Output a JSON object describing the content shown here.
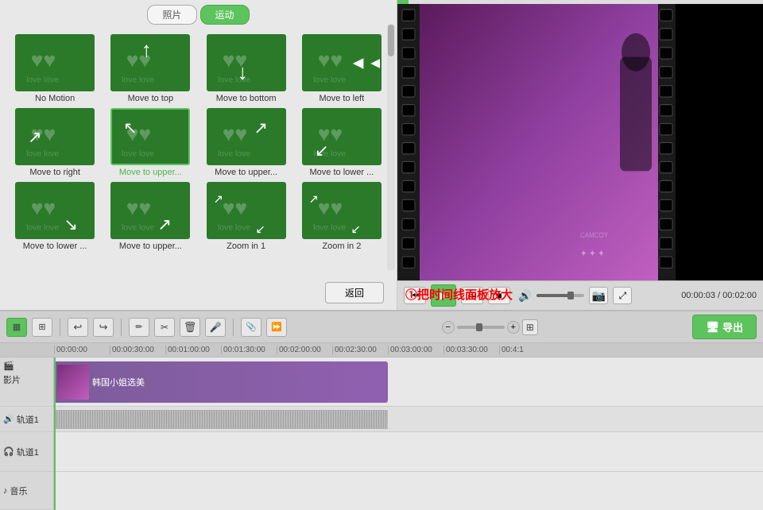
{
  "tabs": {
    "photos_label": "照片",
    "motion_label": "运动"
  },
  "motion_items": [
    {
      "id": "no-motion",
      "label": "No Motion",
      "arrow": "",
      "selected": false
    },
    {
      "id": "move-top",
      "label": "Move to top",
      "arrow": "↑",
      "selected": false
    },
    {
      "id": "move-bottom",
      "label": "Move to bottom",
      "arrow": "↓",
      "selected": false
    },
    {
      "id": "move-left",
      "label": "Move to left",
      "arrow": "◄",
      "selected": false
    },
    {
      "id": "move-right",
      "label": "Move to right",
      "arrow": "↗",
      "selected": false
    },
    {
      "id": "move-upper-left",
      "label": "Move to upper...",
      "arrow": "↖",
      "selected": true
    },
    {
      "id": "move-upper-right",
      "label": "Move to upper...",
      "arrow": "↗",
      "selected": false
    },
    {
      "id": "move-lower-left",
      "label": "Move to lower ...",
      "arrow": "↙",
      "selected": false
    },
    {
      "id": "move-lower-right",
      "label": "Move to lower ...",
      "arrow": "↘",
      "selected": false
    },
    {
      "id": "move-upper-2",
      "label": "Move to upper...",
      "arrow": "↗",
      "selected": false
    },
    {
      "id": "zoom-in-1",
      "label": "Zoom in 1",
      "arrow": "⤢",
      "selected": false
    },
    {
      "id": "zoom-in-2",
      "label": "Zoom in 2",
      "arrow": "⤢",
      "selected": false
    }
  ],
  "back_btn_label": "返回",
  "time_display": "00:00:03 / 00:02:00",
  "annotation_text": "①把时间线面板放大",
  "toolbar": {
    "export_label": "导出",
    "export_icon": "🖥"
  },
  "ruler_marks": [
    "00:00:00",
    "00:00:30:00",
    "00:01:00:00",
    "00:01:30:00",
    "00:02:00:00",
    "00:02:30:00",
    "00:03:00:00",
    "00:03:30:00",
    "00:4:1"
  ],
  "tracks": {
    "video_label": "影片",
    "audio1_label": "轨道1",
    "music_label": "音乐",
    "video_icon": "🎬",
    "audio_icon": "🔊",
    "music_icon": "♪"
  },
  "clip_label": "韩国小姐选美"
}
